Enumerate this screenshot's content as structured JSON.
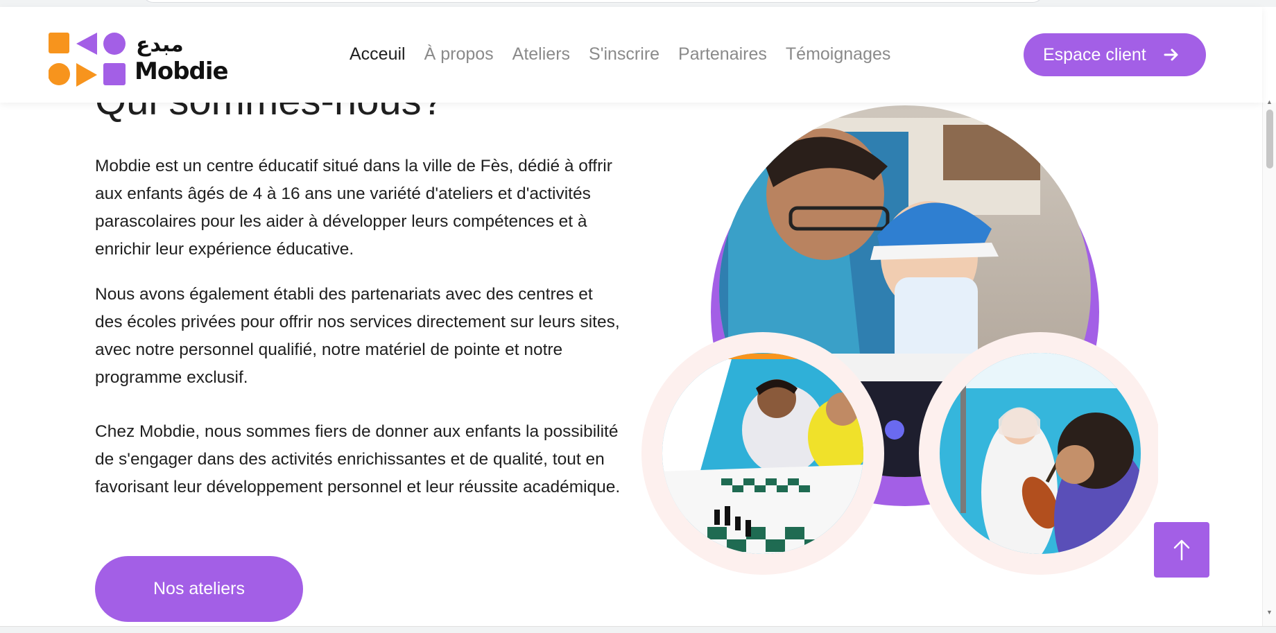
{
  "header": {
    "logo_text": "Mobdie",
    "logo_arabic": "مبدع",
    "nav": [
      {
        "label": "Acceuil",
        "active": true
      },
      {
        "label": "À propos",
        "active": false
      },
      {
        "label": "Ateliers",
        "active": false
      },
      {
        "label": "S'inscrire",
        "active": false
      },
      {
        "label": "Partenaires",
        "active": false
      },
      {
        "label": "Témoignages",
        "active": false
      }
    ],
    "client_button": "Espace client"
  },
  "about": {
    "title": "Qui sommes-nous?",
    "paragraphs": [
      "Mobdie est un centre éducatif situé dans la ville de Fès, dédié à offrir aux enfants âgés de 4 à 16 ans une variété d'ateliers et d'activités parascolaires pour les aider à développer leurs compétences et à enrichir leur expérience éducative.",
      "Nous avons également établi des partenariats avec des centres et des écoles privées pour offrir nos services directement sur leurs sites, avec notre personnel qualifié, notre matériel de pointe et notre programme exclusif.",
      "Chez Mobdie, nous sommes fiers de donner aux enfants la possibilité de s'engager dans des activités enrichissantes et de qualité, tout en favorisant leur développement personnel et leur réussite académique."
    ],
    "cta": "Nos ateliers"
  },
  "colors": {
    "accent": "#a35fe6",
    "orange": "#f7941d",
    "ring_light": "#fdf0ee"
  },
  "icons": {
    "client_button": "arrow-right-icon",
    "scroll_top": "arrow-up-icon"
  }
}
